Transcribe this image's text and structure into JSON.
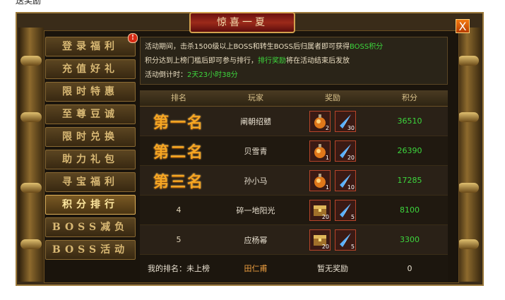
{
  "top_text": "送奖励",
  "window": {
    "title": "惊喜一夏",
    "close_label": "X"
  },
  "menu": [
    {
      "label": "登录福利",
      "badge": "!"
    },
    {
      "label": "充值好礼"
    },
    {
      "label": "限时特惠"
    },
    {
      "label": "至尊豆诚"
    },
    {
      "label": "限时兑换"
    },
    {
      "label": "助力礼包"
    },
    {
      "label": "寻宝福利"
    },
    {
      "label": "积分排行",
      "active": true
    },
    {
      "label": "BOSS减负"
    },
    {
      "label": "BOSS活动"
    }
  ],
  "info": {
    "line1_a": "活动期间，击杀1500级以上BOSS和转生BOSS后归属者即可获得",
    "line1_hl": "BOSS积分",
    "line2_a": "积分达到上榜门槛后即可参与排行，",
    "line2_hl": "排行奖励",
    "line2_b": "将在活动结束后发放",
    "line3_a": "活动倒计时：",
    "line3_hl": "2天23小时38分"
  },
  "table": {
    "headers": [
      "排名",
      "玩家",
      "奖励",
      "积分"
    ],
    "rows": [
      {
        "rank": "第一名",
        "player": "阐朝绍戆",
        "rewards": [
          {
            "icon": "potion-icon",
            "count": "2"
          },
          {
            "icon": "crystal-icon",
            "count": "30"
          }
        ],
        "score": "36510"
      },
      {
        "rank": "第二名",
        "player": "贝雪青",
        "rewards": [
          {
            "icon": "potion-icon",
            "count": "1"
          },
          {
            "icon": "crystal-icon",
            "count": "20"
          }
        ],
        "score": "26390"
      },
      {
        "rank": "第三名",
        "player": "孙小马",
        "rewards": [
          {
            "icon": "potion-icon",
            "count": "1"
          },
          {
            "icon": "crystal-icon",
            "count": "10"
          }
        ],
        "score": "17285"
      },
      {
        "rank": "4",
        "player": "碎一地阳光",
        "rewards": [
          {
            "icon": "chest-icon",
            "count": "20"
          },
          {
            "icon": "crystal-icon",
            "count": "5"
          }
        ],
        "score": "8100"
      },
      {
        "rank": "5",
        "player": "应杨幂",
        "rewards": [
          {
            "icon": "chest-icon",
            "count": "20"
          },
          {
            "icon": "crystal-icon",
            "count": "5"
          }
        ],
        "score": "3300"
      }
    ],
    "mine": {
      "rank_label": "我的排名：未上榜",
      "player": "田仁甫",
      "reward": "暂无奖励",
      "score": "0"
    }
  },
  "colors": {
    "accent_green": "#3dd63d",
    "rank_gold": "#f5a623",
    "close_orange": "#f47a12"
  }
}
